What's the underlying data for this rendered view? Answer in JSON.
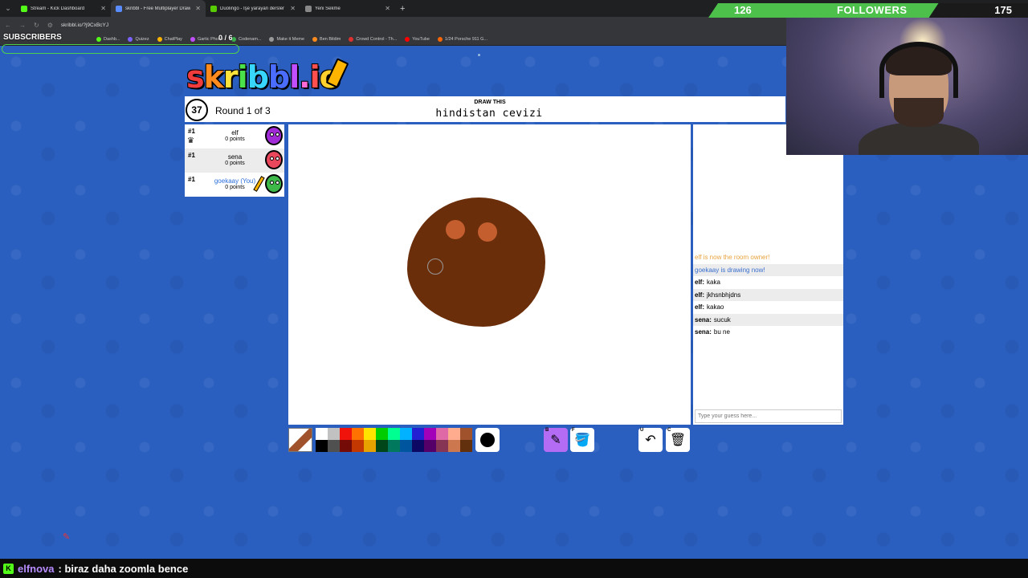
{
  "browser": {
    "tabs": [
      {
        "title": "Stream - Kick Dashboard",
        "color": "#53fc18",
        "active": false
      },
      {
        "title": "skribbl - Free Multiplayer Draw",
        "color": "#5a8cff",
        "active": true
      },
      {
        "title": "Duolingo - İşe yarayan dersler",
        "color": "#58cc02",
        "active": false
      },
      {
        "title": "Yeni Sekme",
        "color": "#888888",
        "active": false
      }
    ],
    "url": "skribbl.io/?j9CxBcYJ",
    "bookmarks": [
      {
        "label": "Dashb...",
        "color": "#53fc18"
      },
      {
        "label": "Quizez",
        "color": "#7b61ff"
      },
      {
        "label": "ChatPlay",
        "color": "#ffb400"
      },
      {
        "label": "Gartic Phone",
        "color": "#c04fff"
      },
      {
        "label": "Codenam...",
        "color": "#37b24d"
      },
      {
        "label": "Make it Meme",
        "color": "#999999"
      },
      {
        "label": "Ben Bildim",
        "color": "#ff8b1f"
      },
      {
        "label": "Crowd Control - Th...",
        "color": "#e03131"
      },
      {
        "label": "YouTube",
        "color": "#ff0000"
      },
      {
        "label": "1/24 Porsche 911 G...",
        "color": "#f76707"
      }
    ]
  },
  "overlay": {
    "subscribers_label": "SUBSCRIBERS",
    "subscribers_count": "0 / 6",
    "followers_current": "126",
    "followers_label": "FOLLOWERS",
    "followers_goal": "175",
    "followers_progress": 0.72,
    "chat": {
      "user": "elfnova",
      "message": ": biraz daha zoomla bence"
    }
  },
  "game": {
    "timer": "37",
    "round": "Round 1 of 3",
    "draw_this_label": "DRAW THIS",
    "word": "hindistan cevizi",
    "players": [
      {
        "rank": "#1",
        "name": "elf",
        "points": "0 points",
        "owner": true,
        "you": false,
        "avatar_color": "#a12bd6"
      },
      {
        "rank": "#1",
        "name": "sena",
        "points": "0 points",
        "owner": false,
        "you": false,
        "avatar_color": "#e8475c"
      },
      {
        "rank": "#1",
        "name": "goekaay (You)",
        "points": "0 points",
        "owner": false,
        "you": true,
        "avatar_color": "#3fb84a"
      }
    ],
    "chat": [
      {
        "type": "owner",
        "text": "elf is now the room owner!"
      },
      {
        "type": "drawing",
        "text": "goekaay is drawing now!"
      },
      {
        "type": "guess",
        "user": "elf:",
        "text": "kaka"
      },
      {
        "type": "guess",
        "user": "elf:",
        "text": "jkhsnbhjdns"
      },
      {
        "type": "guess",
        "user": "elf:",
        "text": "kakao"
      },
      {
        "type": "guess",
        "user": "sena:",
        "text": "sucuk"
      },
      {
        "type": "guess",
        "user": "sena:",
        "text": "bu ne"
      }
    ],
    "guess_placeholder": "Type your guess here...",
    "palette": [
      "#ffffff",
      "#c1c1c1",
      "#ef130b",
      "#ff7100",
      "#ffe400",
      "#00cc00",
      "#00ff91",
      "#00b2ff",
      "#231fd3",
      "#a300ba",
      "#df69a7",
      "#ffac8e",
      "#a0522d",
      "#000000",
      "#505050",
      "#740b07",
      "#c23800",
      "#e8a200",
      "#004619",
      "#00785d",
      "#00569e",
      "#0e0865",
      "#550069",
      "#873554",
      "#cc774d",
      "#63300d"
    ],
    "tool_keys": {
      "pencil": "B",
      "fill": "F",
      "undo": "U",
      "clear": "C"
    }
  }
}
